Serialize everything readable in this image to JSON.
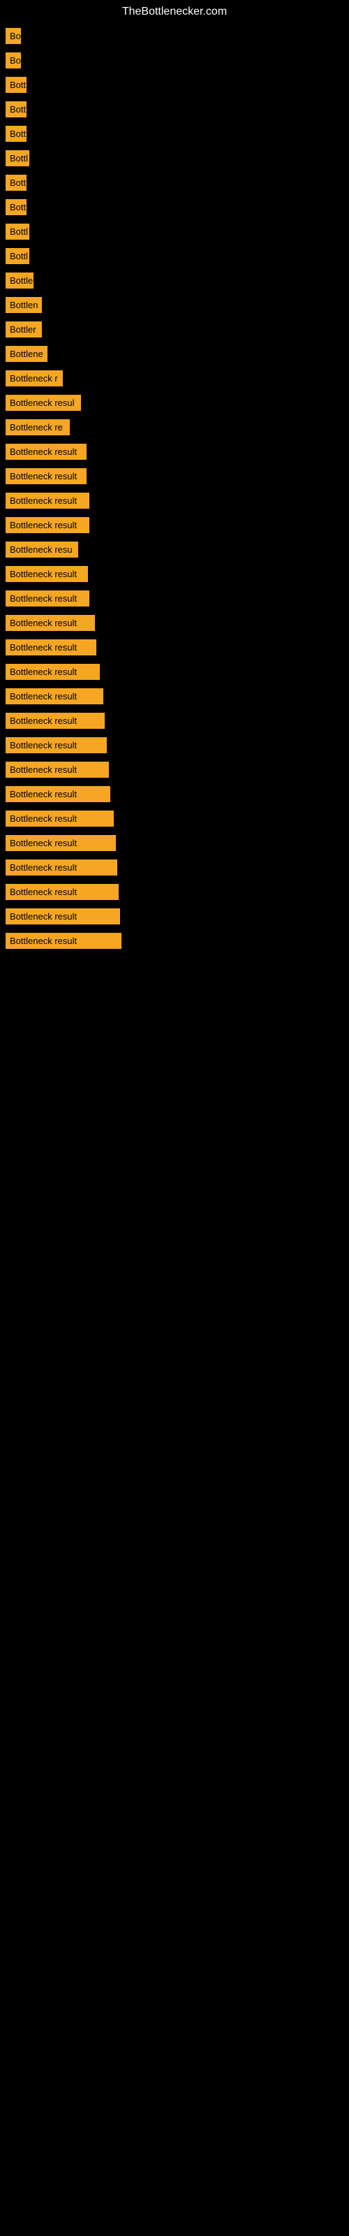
{
  "header": {
    "title": "TheBottlenecker.com"
  },
  "items": [
    {
      "label": "Bo",
      "width": 22
    },
    {
      "label": "Bo",
      "width": 22
    },
    {
      "label": "Bott",
      "width": 30
    },
    {
      "label": "Bott",
      "width": 30
    },
    {
      "label": "Bott",
      "width": 30
    },
    {
      "label": "Bottl",
      "width": 34
    },
    {
      "label": "Bott",
      "width": 30
    },
    {
      "label": "Bott",
      "width": 30
    },
    {
      "label": "Bottl",
      "width": 34
    },
    {
      "label": "Bottl",
      "width": 34
    },
    {
      "label": "Bottle",
      "width": 40
    },
    {
      "label": "Bottlen",
      "width": 52
    },
    {
      "label": "Bottler",
      "width": 52
    },
    {
      "label": "Bottlene",
      "width": 60
    },
    {
      "label": "Bottleneck r",
      "width": 82
    },
    {
      "label": "Bottleneck resul",
      "width": 108
    },
    {
      "label": "Bottleneck re",
      "width": 92
    },
    {
      "label": "Bottleneck result",
      "width": 116
    },
    {
      "label": "Bottleneck result",
      "width": 116
    },
    {
      "label": "Bottleneck result",
      "width": 120
    },
    {
      "label": "Bottleneck result",
      "width": 120
    },
    {
      "label": "Bottleneck resu",
      "width": 104
    },
    {
      "label": "Bottleneck result",
      "width": 118
    },
    {
      "label": "Bottleneck result",
      "width": 120
    },
    {
      "label": "Bottleneck result",
      "width": 128
    },
    {
      "label": "Bottleneck result",
      "width": 130
    },
    {
      "label": "Bottleneck result",
      "width": 135
    },
    {
      "label": "Bottleneck result",
      "width": 140
    },
    {
      "label": "Bottleneck result",
      "width": 142
    },
    {
      "label": "Bottleneck result",
      "width": 145
    },
    {
      "label": "Bottleneck result",
      "width": 148
    },
    {
      "label": "Bottleneck result",
      "width": 150
    },
    {
      "label": "Bottleneck result",
      "width": 155
    },
    {
      "label": "Bottleneck result",
      "width": 158
    },
    {
      "label": "Bottleneck result",
      "width": 160
    },
    {
      "label": "Bottleneck result",
      "width": 162
    },
    {
      "label": "Bottleneck result",
      "width": 164
    },
    {
      "label": "Bottleneck result",
      "width": 166
    }
  ]
}
